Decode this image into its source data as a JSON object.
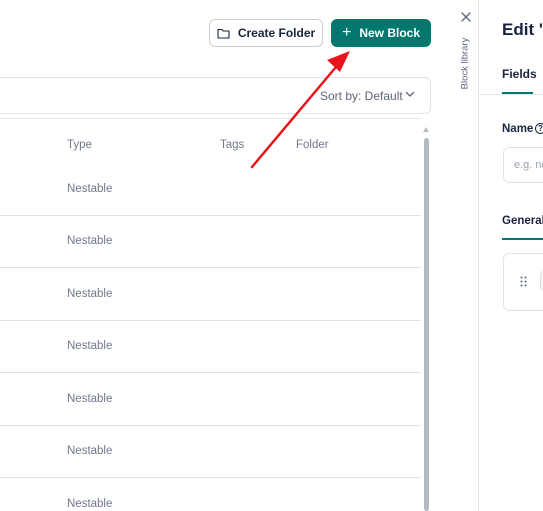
{
  "toolbar": {
    "create_folder_label": "Create Folder",
    "new_block_label": "New Block",
    "new_block_plus": "+"
  },
  "sort": {
    "label": "Sort by: Default"
  },
  "table": {
    "columns": [
      "Type",
      "Tags",
      "Folder"
    ],
    "rows": [
      {
        "type": "Nestable"
      },
      {
        "type": "Nestable"
      },
      {
        "type": "Nestable"
      },
      {
        "type": "Nestable"
      },
      {
        "type": "Nestable"
      },
      {
        "type": "Nestable"
      },
      {
        "type": "Nestable"
      }
    ]
  },
  "sidebar": {
    "vertical_label": "Block library"
  },
  "panel": {
    "title": "Edit 'p",
    "tab_fields": "Fields",
    "name_label": "Name",
    "help_mark": "?",
    "name_placeholder": "e.g. ne",
    "general_label": "General"
  },
  "colors": {
    "accent": "#00786e",
    "annotation_arrow": "#e8131b"
  }
}
